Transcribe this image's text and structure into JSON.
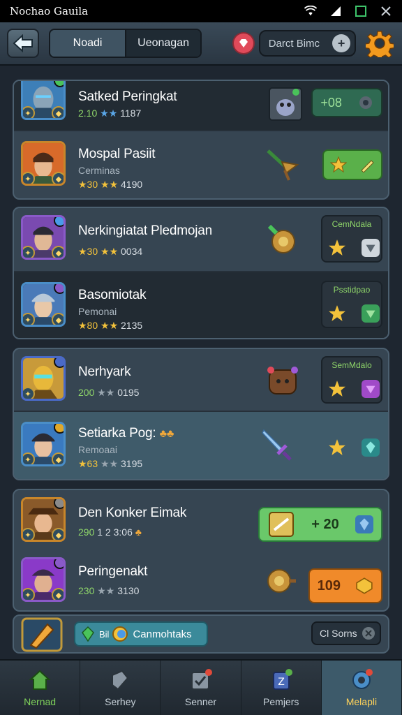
{
  "status_bar": {
    "title": "Nochao Gauila"
  },
  "header": {
    "tabs": [
      {
        "label": "Noadi",
        "active": true
      },
      {
        "label": "Ueonagan",
        "active": false
      }
    ],
    "search_label": "Darct Bimc"
  },
  "rows": [
    {
      "title": "Satked Peringkat",
      "sub": "",
      "lvl": "2.10",
      "stars": "★★",
      "num": "1187"
    },
    {
      "title": "Mospal Pasiit",
      "sub": "Cerminas",
      "lvl": "★30",
      "stars": "★★",
      "num": "4190"
    },
    {
      "title": "Nerkingiatat Pledmojan",
      "sub": "",
      "lvl": "★30",
      "stars": "★★",
      "num": "0034"
    },
    {
      "title": "Basomiotak",
      "sub": "Pemonai",
      "lvl": "★80",
      "stars": "★★",
      "num": "2135"
    },
    {
      "title": "Nerhyark",
      "sub": "",
      "lvl": "200",
      "stars": "★★",
      "num": "0195"
    },
    {
      "title": "Setiarka Pog:",
      "sub": "Remoaai",
      "lvl": "★63",
      "stars": "★★",
      "num": "3195"
    },
    {
      "title": "Den Konker Eimak",
      "sub": "",
      "lvl": "290",
      "stars": "1 2",
      "num": "3:06"
    },
    {
      "title": "Peringenakt",
      "sub": "",
      "lvl": "230",
      "stars": "★★",
      "num": "3130"
    }
  ],
  "actions": {
    "row1_value": "+08",
    "row3_slot_label": "CemNdala",
    "row4_slot_label": "Psstidpao",
    "row5_slot_label": "SemMdalo",
    "row7_value": "+ 20",
    "row8_value": "109"
  },
  "bottom_strip": {
    "pill_prefix": "Bil",
    "pill_label": "Canmohtaks",
    "sort_label": "Cl Sorns"
  },
  "nav": [
    {
      "label": "Nernad"
    },
    {
      "label": "Serhey"
    },
    {
      "label": "Senner"
    },
    {
      "label": "Pemjers"
    },
    {
      "label": "Melapli"
    }
  ],
  "colors": {
    "accent_green": "#7fd25a",
    "accent_gold": "#f3c23b",
    "panel": "#364552",
    "button_orange": "#f08a2a"
  }
}
